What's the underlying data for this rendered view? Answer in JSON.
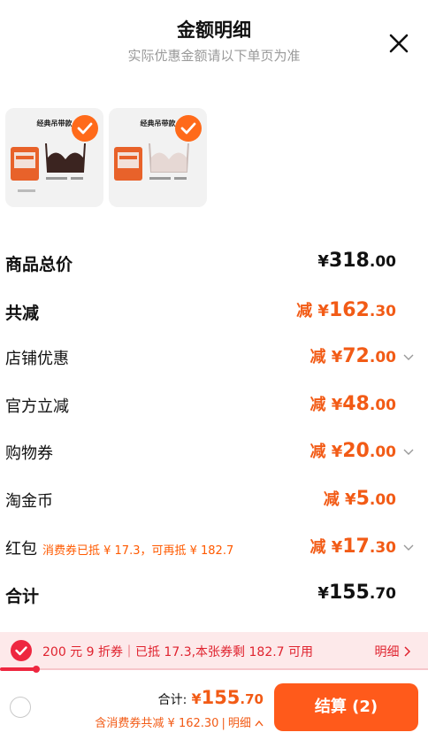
{
  "header": {
    "title": "金额明细",
    "subtitle": "实际优惠金额请以下单页为准"
  },
  "products": [
    {
      "title": "经典吊带款",
      "note_left": "厚度5mm的胸垫",
      "note_mid": "适合A~D杯",
      "note_right": "无痕贴",
      "color": "#3b2420"
    },
    {
      "title": "经典吊带款",
      "note_left": "厚度5mm的胸垫",
      "note_mid": "适合A~D杯",
      "note_right": "无痕贴",
      "color": "#e6d8d4"
    }
  ],
  "rows": [
    {
      "id": "goods-total",
      "label": "商品总价",
      "prefix": "¥",
      "integer": "318",
      "decimal": ".00",
      "style": "black",
      "bold": true,
      "chevron": false
    },
    {
      "id": "total-discount",
      "label": "共减",
      "prefix": "减 ¥",
      "integer": "162",
      "decimal": ".30",
      "style": "orange",
      "bold": true,
      "chevron": false
    },
    {
      "id": "store-discount",
      "label": "店铺优惠",
      "prefix": "减 ¥",
      "integer": "72",
      "decimal": ".00",
      "style": "orange",
      "bold": false,
      "chevron": true
    },
    {
      "id": "official-discount",
      "label": "官方立减",
      "prefix": "减 ¥",
      "integer": "48",
      "decimal": ".00",
      "style": "orange",
      "bold": false,
      "chevron": false
    },
    {
      "id": "shopping-voucher",
      "label": "购物券",
      "prefix": "减 ¥",
      "integer": "20",
      "decimal": ".00",
      "style": "orange",
      "bold": false,
      "chevron": true
    },
    {
      "id": "taojinbi",
      "label": "淘金币",
      "prefix": "减 ¥",
      "integer": "5",
      "decimal": ".00",
      "style": "orange",
      "bold": false,
      "chevron": false
    },
    {
      "id": "red-packet",
      "label": "红包",
      "note": "消费券已抵 ¥ 17.3，可再抵 ¥ 182.7",
      "prefix": "减 ¥",
      "integer": "17",
      "decimal": ".30",
      "style": "orange",
      "bold": false,
      "chevron": true
    },
    {
      "id": "total",
      "label": "合计",
      "prefix": "¥",
      "integer": "155",
      "decimal": ".70",
      "style": "black",
      "bold": true,
      "chevron": false
    }
  ],
  "coupon": {
    "text": "200 元 9 折券｜已抵 17.3,本张券剩 182.7 可用",
    "detail": "明细",
    "progress": 0.085
  },
  "footer": {
    "total_label": "合计:",
    "total_currency": "¥",
    "total_integer": "155",
    "total_decimal": ".70",
    "sub_text": "含消费券共减 ¥ 162.30",
    "sub_detail": "明细",
    "checkout_label": "结算 (2)"
  },
  "colors": {
    "accent": "#ff5a1b",
    "discount": "#f25b16",
    "coupon_red": "#ee2740"
  }
}
